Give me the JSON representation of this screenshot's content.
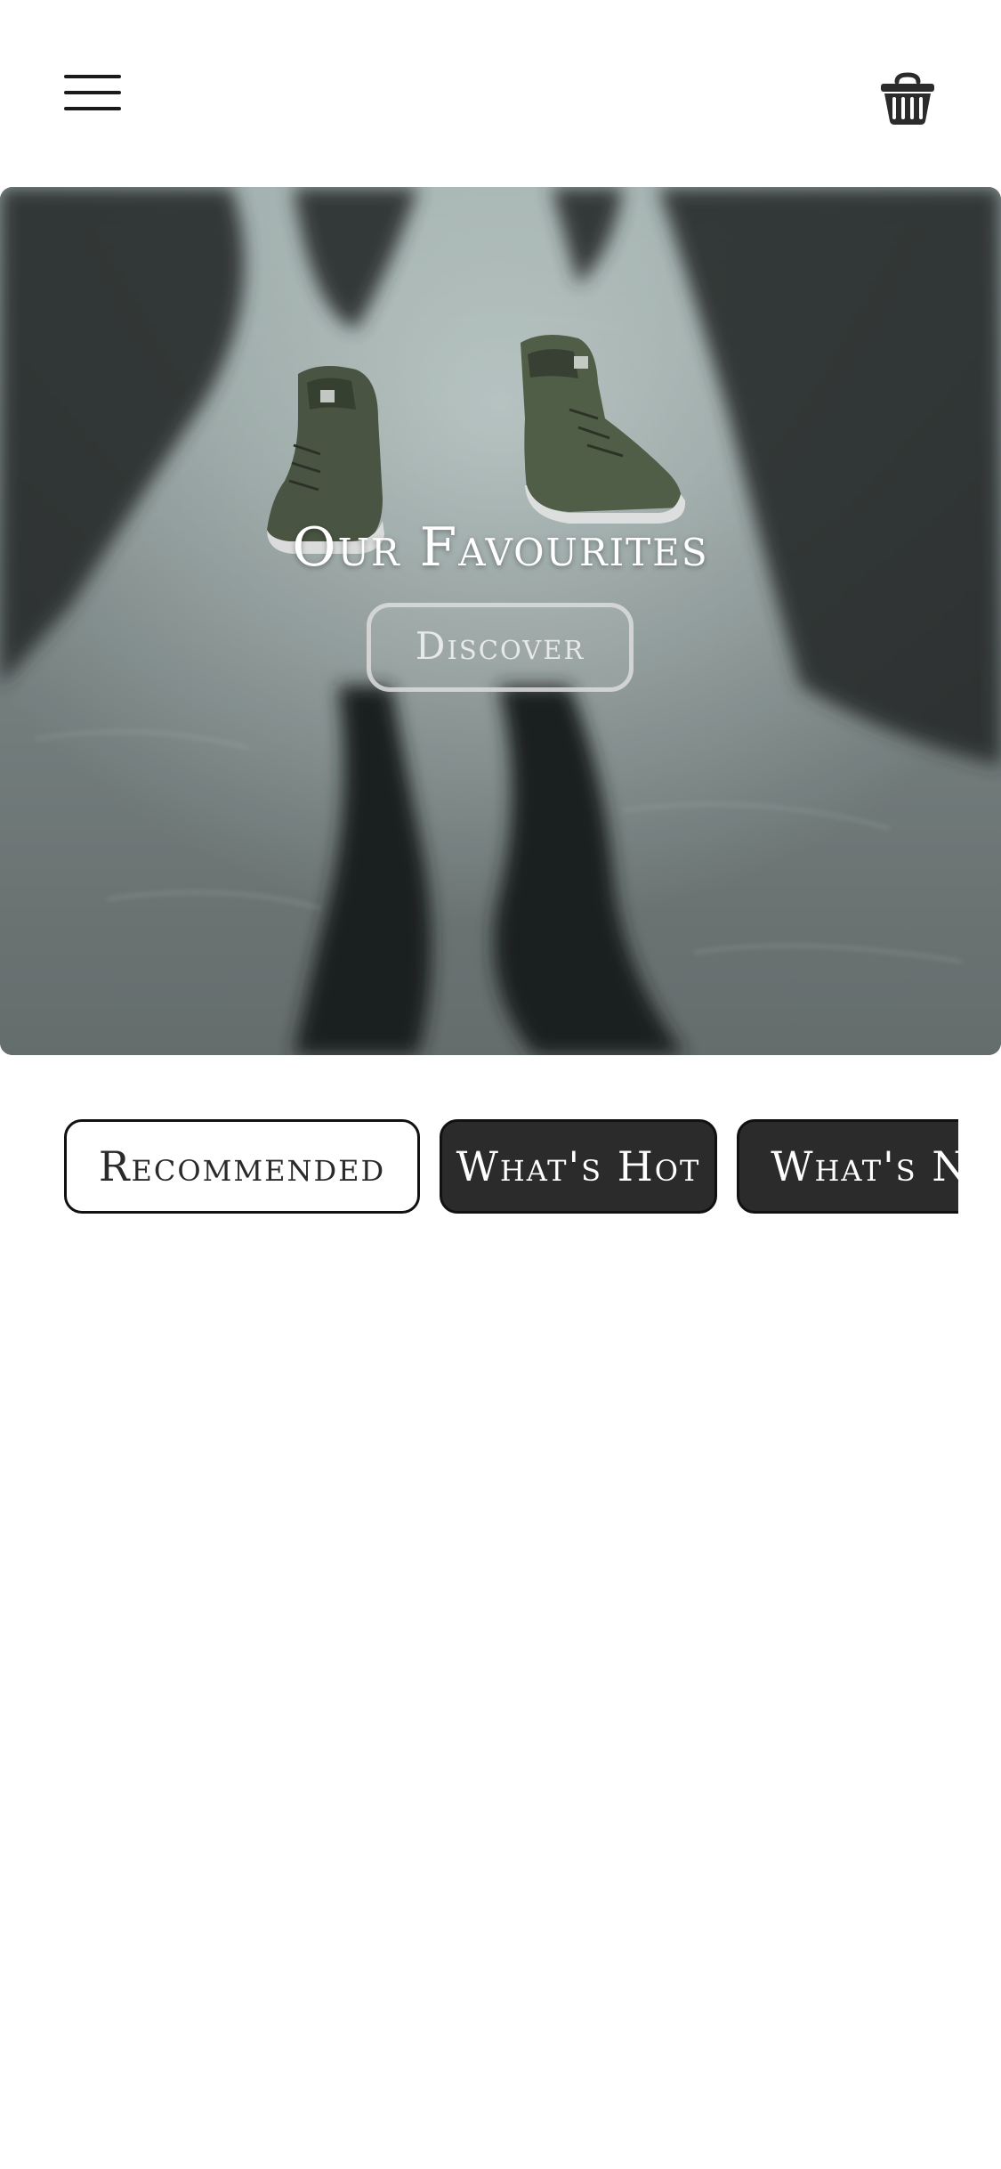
{
  "header": {
    "menu_icon": "hamburger-menu-icon",
    "cart_icon": "basket-icon"
  },
  "hero": {
    "title": "Our Favourites",
    "button_label": "Discover",
    "image_description_icon": "sneakers-photo"
  },
  "tabs": [
    {
      "label": "Recommended",
      "active": true
    },
    {
      "label": "What's Hot",
      "active": false
    },
    {
      "label": "What's New",
      "active": false
    }
  ],
  "colors": {
    "background": "#ffffff",
    "text_dark": "#1a1a1a",
    "tab_dark": "#2b2b2b",
    "tab_border": "#111111",
    "hero_text": "#ffffff"
  }
}
